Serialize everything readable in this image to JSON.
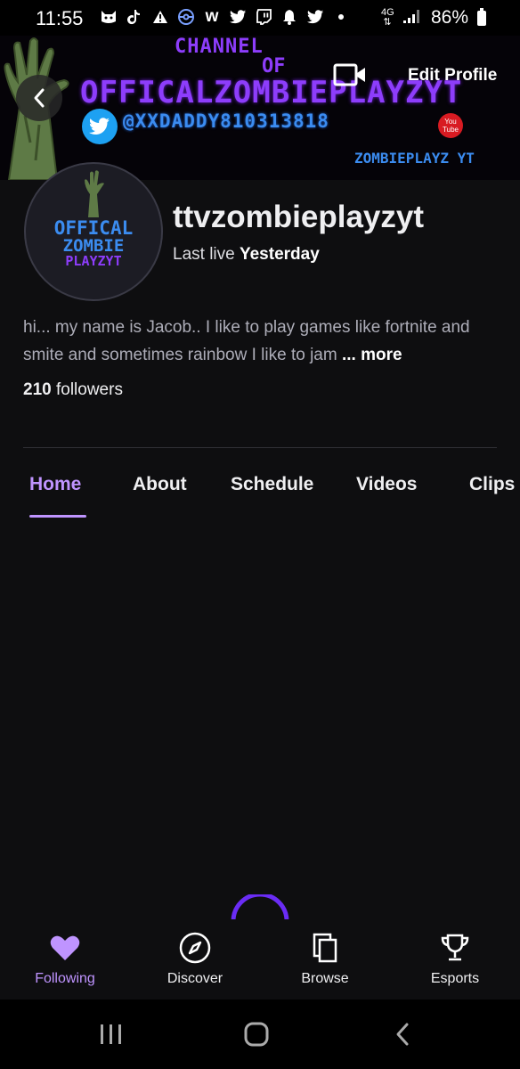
{
  "status_bar": {
    "time": "11:55",
    "battery": "86%",
    "network": "4G",
    "icons": [
      "cat-icon",
      "tiktok-icon",
      "alert-icon",
      "pokeball-icon",
      "wattpad-icon",
      "twitter-icon",
      "twitch-icon",
      "bell-icon",
      "twitter-icon",
      "dot-icon"
    ]
  },
  "banner": {
    "line1": "CHANNEL",
    "line2": "OF",
    "title": "OFFICALZOMBIEPLAYZYT",
    "twitter_handle": "@XXDADDY810313818",
    "footer": "ZOMBIEPLAYZ YT",
    "youtube_badge_top": "You",
    "youtube_badge_bottom": "Tube"
  },
  "header": {
    "edit_profile": "Edit Profile"
  },
  "avatar": {
    "line1": "OFFICAL",
    "line2": "ZOMBIE",
    "line3": "PLAYZYT"
  },
  "profile": {
    "username": "ttvzombieplayzyt",
    "last_live_label": "Last live",
    "last_live_value": "Yesterday",
    "bio": "hi... my name is Jacob.. I like to play games like fortnite and smite and sometimes rainbow I like to jam ",
    "bio_more": "... more",
    "followers_count": "210",
    "followers_label": "followers"
  },
  "tabs": [
    {
      "label": "Home",
      "active": true
    },
    {
      "label": "About",
      "active": false
    },
    {
      "label": "Schedule",
      "active": false
    },
    {
      "label": "Videos",
      "active": false
    },
    {
      "label": "Clips",
      "active": false
    }
  ],
  "bottom_nav": [
    {
      "label": "Following",
      "icon": "heart-icon",
      "active": true
    },
    {
      "label": "Discover",
      "icon": "compass-icon",
      "active": false
    },
    {
      "label": "Browse",
      "icon": "browse-icon",
      "active": false
    },
    {
      "label": "Esports",
      "icon": "trophy-icon",
      "active": false
    }
  ],
  "colors": {
    "accent": "#bf94ff",
    "background": "#0e0e10",
    "text": "#efeff1",
    "banner_purple": "#8d3dfb",
    "banner_blue": "#3b8cf0"
  }
}
